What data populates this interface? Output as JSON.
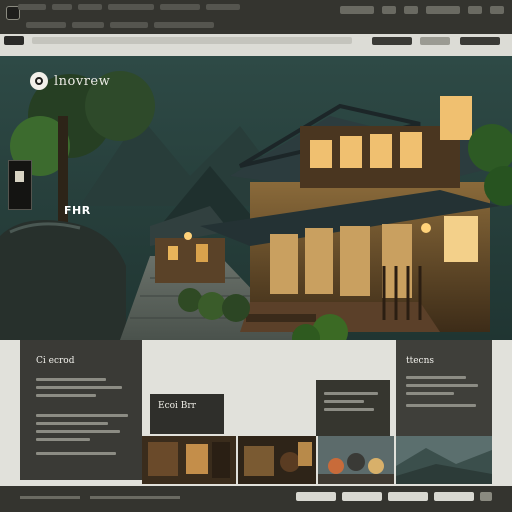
{
  "brand": {
    "name": "lnovrew"
  },
  "hero": {
    "tag": "FHR"
  },
  "panels": {
    "left_title": "Ci ecrod",
    "right_title": "ttecns",
    "caption": "Ecoi Brr"
  },
  "colors": {
    "chrome": "#34342f",
    "content_bg": "#e1e1db",
    "panel_dark": "#3a3a36",
    "accent_warm": "#f0c070"
  },
  "icons": {
    "logo": "circle-logo-icon",
    "menu": "menu-icon",
    "home": "home-icon"
  }
}
